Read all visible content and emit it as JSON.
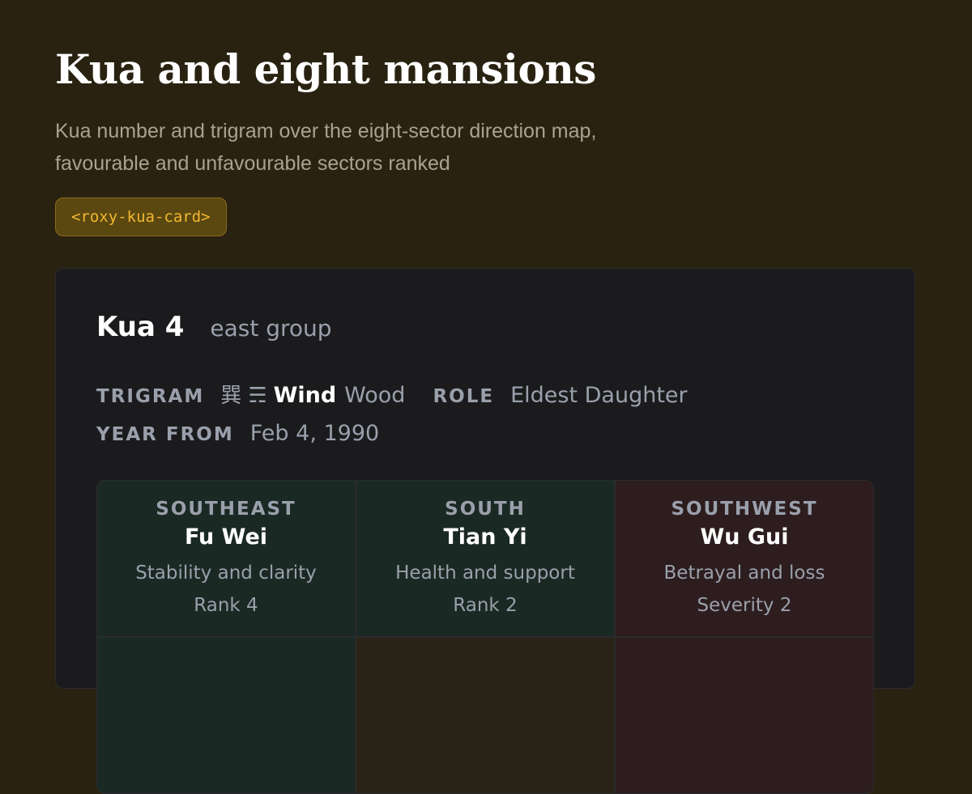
{
  "header": {
    "title": "Kua and eight mansions",
    "subtitle": "Kua number and trigram over the eight-sector direction map, favourable and unfavourable sectors ranked",
    "tag": "<roxy-kua-card>"
  },
  "card": {
    "kua_label": "Kua 4",
    "group": "east group",
    "trigram_label": "TRIGRAM",
    "trigram_char": "巽",
    "trigram_symbol": "☴",
    "trigram_name": "Wind",
    "trigram_element": "Wood",
    "role_label": "ROLE",
    "role_value": "Eldest Daughter",
    "year_label": "YEAR FROM",
    "year_value": "Feb 4, 1990"
  },
  "sectors": [
    {
      "direction": "SOUTHEAST",
      "name": "Fu Wei",
      "description": "Stability and clarity",
      "rank": "Rank 4",
      "tone": "favourable"
    },
    {
      "direction": "SOUTH",
      "name": "Tian Yi",
      "description": "Health and support",
      "rank": "Rank 2",
      "tone": "favourable"
    },
    {
      "direction": "SOUTHWEST",
      "name": "Wu Gui",
      "description": "Betrayal and loss",
      "rank": "Severity 2",
      "tone": "unfavourable"
    }
  ],
  "colors": {
    "page_bg": "#2a2211",
    "card_bg": "#1b1b1d",
    "favourable_bg": "#1b2924",
    "unfavourable_bg": "#2d1d1f",
    "tag_text": "#f2b632"
  }
}
